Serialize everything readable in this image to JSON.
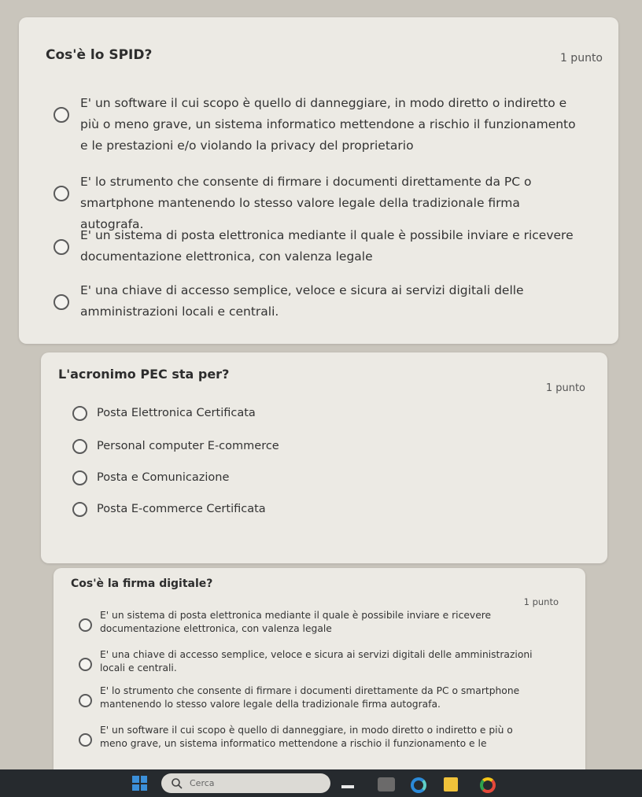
{
  "q1": {
    "title": "Cos'è lo SPID?",
    "points": "1 punto",
    "options": [
      "E' un software il cui scopo è quello di danneggiare, in modo diretto o indiretto e più o meno grave, un sistema informatico mettendone a rischio il funzionamento e le prestazioni e/o violando la privacy del proprietario",
      "E' lo strumento che consente di firmare i documenti direttamente da PC o smartphone mantenendo lo stesso valore legale della tradizionale firma autografa.",
      "E' un sistema di posta elettronica mediante il quale è possibile inviare e ricevere documentazione elettronica, con valenza legale",
      "E'  una chiave di accesso semplice, veloce e sicura ai servizi digitali delle amministrazioni locali e centrali."
    ]
  },
  "q2": {
    "title": "L'acronimo PEC sta per?",
    "points": "1 punto",
    "options": [
      "Posta Elettronica Certificata",
      "Personal computer E-commerce",
      "Posta e Comunicazione",
      "Posta E-commerce Certificata"
    ]
  },
  "q3": {
    "title": "Cos'è la firma digitale?",
    "points": "1 punto",
    "options": [
      "E' un sistema di posta elettronica mediante il quale è possibile inviare e ricevere documentazione elettronica, con valenza legale",
      "E'  una chiave di accesso semplice, veloce e sicura ai servizi digitali delle amministrazioni locali e centrali.",
      "E' lo strumento che consente di firmare i documenti direttamente da PC o smartphone mantenendo lo stesso valore legale della tradizionale firma autografa.",
      "E' un software il cui scopo è quello di danneggiare, in modo diretto o indiretto e più o meno grave, un sistema informatico mettendone a rischio il funzionamento e le"
    ]
  },
  "taskbar": {
    "search_placeholder": "Cerca",
    "icons": [
      "windows-start-icon",
      "search-icon",
      "widget-icon",
      "app-icon",
      "edge-browser-icon",
      "file-explorer-icon",
      "chrome-icon"
    ]
  },
  "colors": {
    "page_bg": "#c9c5bc",
    "card_bg": "#eceae4",
    "taskbar_bg": "#262a2e",
    "start_blue": "#3b8fd9"
  }
}
